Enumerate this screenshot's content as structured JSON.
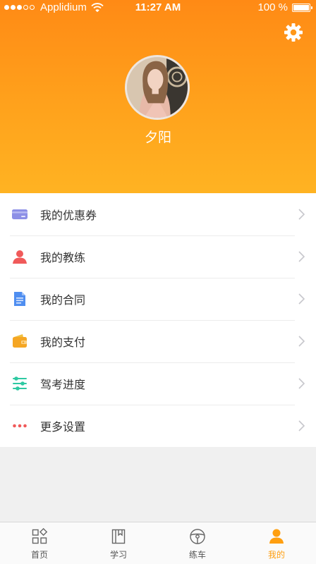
{
  "status_bar": {
    "carrier": "Applidium",
    "time": "11:27 AM",
    "battery": "100 %",
    "signal_bars": 3,
    "signal_total": 5,
    "battery_level": 1.0
  },
  "profile": {
    "user_name": "夕阳",
    "avatar_icon": "user-avatar-photo",
    "settings_icon": "gear-icon"
  },
  "menu": {
    "items": [
      {
        "label": "我的优惠券",
        "icon": "coupon-icon",
        "color": "#8c8fe6"
      },
      {
        "label": "我的教练",
        "icon": "coach-icon",
        "color": "#f05a5a"
      },
      {
        "label": "我的合同",
        "icon": "contract-icon",
        "color": "#4f8ef0"
      },
      {
        "label": "我的支付",
        "icon": "wallet-icon",
        "color": "#f5a623"
      },
      {
        "label": "驾考进度",
        "icon": "progress-sliders-icon",
        "color": "#2ec9a2"
      },
      {
        "label": "更多设置",
        "icon": "more-dots-icon",
        "color": "#f05a5a"
      }
    ]
  },
  "tabbar": {
    "tabs": [
      {
        "label": "首页",
        "icon": "home-grid-icon",
        "active": false
      },
      {
        "label": "学习",
        "icon": "book-icon",
        "active": false
      },
      {
        "label": "练车",
        "icon": "steering-wheel-icon",
        "active": false
      },
      {
        "label": "我的",
        "icon": "person-icon",
        "active": true
      }
    ],
    "active_color": "#ff9f10",
    "inactive_color": "#555555"
  },
  "colors": {
    "header_gradient_top": "#ff8a15",
    "header_gradient_bottom": "#ffb322",
    "background": "#f0f0f0"
  }
}
